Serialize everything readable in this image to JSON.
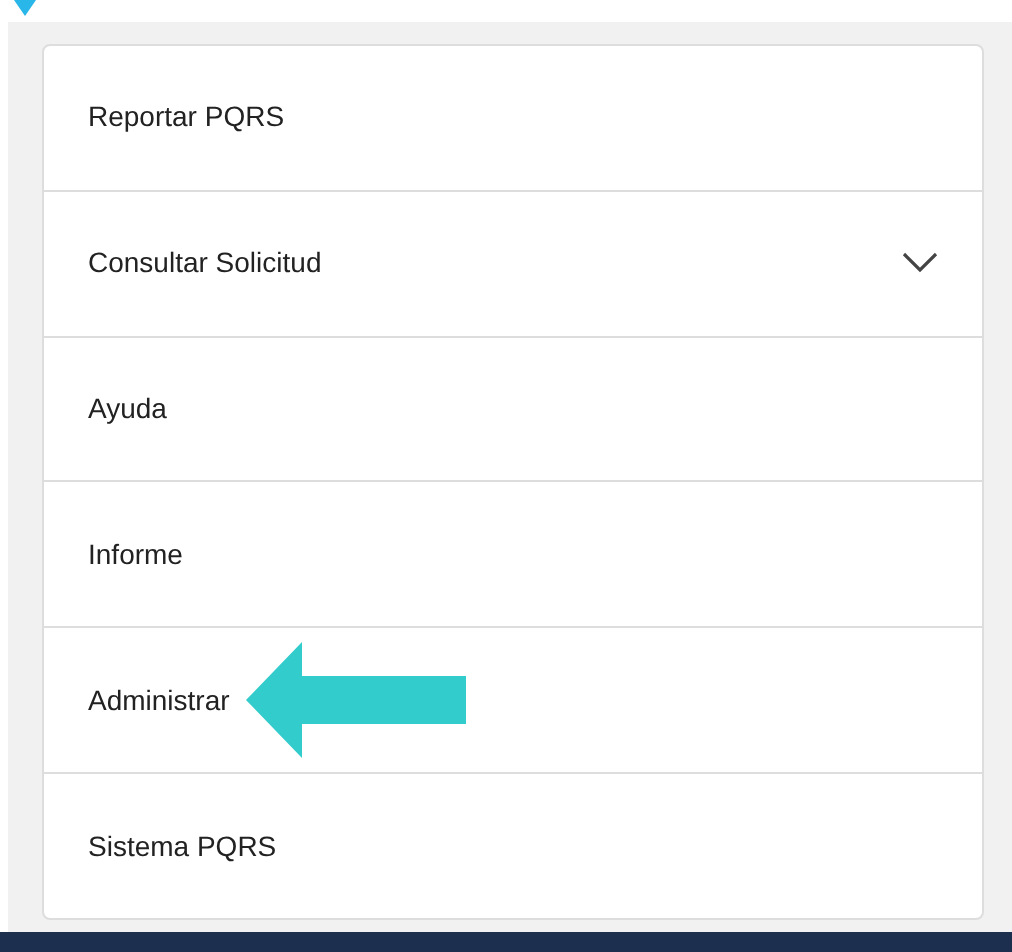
{
  "menu": {
    "items": [
      {
        "label": "Reportar PQRS",
        "pointed": false
      },
      {
        "label": "Consultar Solicitud",
        "expandable": true,
        "expanded": false,
        "pointed": false
      },
      {
        "label": "Ayuda",
        "pointed": false
      },
      {
        "label": "Informe",
        "pointed": false
      },
      {
        "label": "Administrar",
        "pointed": true
      },
      {
        "label": "Sistema PQRS",
        "pointed": false
      }
    ]
  }
}
